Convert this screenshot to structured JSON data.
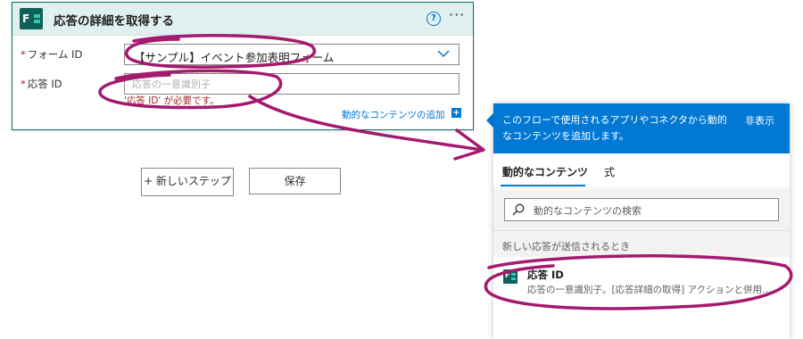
{
  "card": {
    "title": "応答の詳細を取得する",
    "help_glyph": "?",
    "more_glyph": "···",
    "fields": {
      "form_id": {
        "label": "フォーム ID",
        "required_mark": "*",
        "value": "【サンプル】イベント参加表明フォーム"
      },
      "response_id": {
        "label": "応答 ID",
        "required_mark": "*",
        "placeholder": "応答の一意識別子",
        "value": "",
        "error": "'応答 ID' が必要です。"
      }
    },
    "add_dynamic_content": "動的なコンテンツの追加",
    "add_dynamic_glyph": "+"
  },
  "buttons": {
    "new_step": "+ 新しいステップ",
    "save": "保存"
  },
  "flyout": {
    "description": "このフローで使用されるアプリやコネクタから動的なコンテンツを追加します。",
    "hide": "非表示",
    "tabs": [
      {
        "label": "動的なコンテンツ",
        "selected": true
      },
      {
        "label": "式",
        "selected": false
      }
    ],
    "search_placeholder": "動的なコンテンツの検索",
    "group_title": "新しい応答が送信されるとき",
    "items": [
      {
        "name": "応答 ID",
        "description": "応答の一意識別子。[応答詳細の取得] アクションと併用して..."
      }
    ]
  },
  "colors": {
    "accent": "#0078d4",
    "forms_brand": "#0e6157",
    "error": "#a4262c",
    "annotation": "#a41a6e"
  }
}
